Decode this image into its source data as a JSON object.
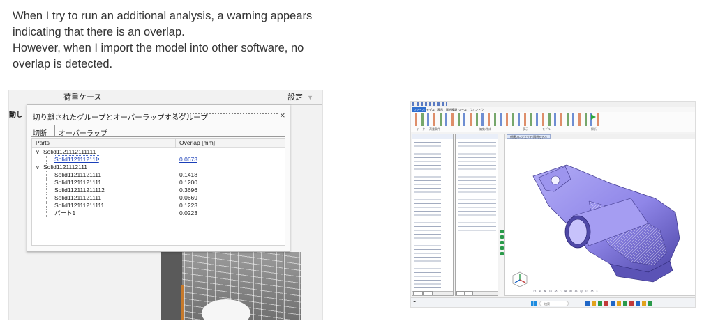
{
  "post": {
    "lines": [
      "When I try to run an additional analysis, a warning appears",
      "indicating that there is an overlap.",
      "However, when I import the model into other software, no",
      "overlap is detected."
    ]
  },
  "left_screenshot": {
    "tab_load_case": "荷重ケース",
    "tab_settings": "設定",
    "side_label": "動し",
    "dialog": {
      "title": "切り離されたグループとオーバーラップするグループ",
      "close": "×",
      "tabs": [
        "切断",
        "オーバーラップ"
      ],
      "columns": [
        "Parts",
        "Overlap [mm]"
      ],
      "rows": [
        {
          "name": "Solid1121112111111",
          "value": "",
          "level": 0,
          "expanded": true
        },
        {
          "name": "Solid1121112111",
          "value": "0.0673",
          "level": 1,
          "link": true
        },
        {
          "name": "Solid1121112111",
          "value": "",
          "level": 0,
          "expanded": true
        },
        {
          "name": "Solid11211121111",
          "value": "0.1418",
          "level": 1
        },
        {
          "name": "Solid11211121111",
          "value": "0.1200",
          "level": 1
        },
        {
          "name": "Solid112111211112",
          "value": "0.3696",
          "level": 1
        },
        {
          "name": "Solid11211121111",
          "value": "0.0669",
          "level": 1
        },
        {
          "name": "Solid112111211111",
          "value": "0.1223",
          "level": 1
        },
        {
          "name": "パート1",
          "value": "0.0223",
          "level": 1
        }
      ]
    }
  },
  "right_screenshot": {
    "menu": [
      "ファイル",
      "モデル",
      "表示",
      "解析種類",
      "ツール",
      "ウィンドウ"
    ],
    "ribbon_groups": [
      "データ",
      "荷重条件",
      "編集/作成",
      "表示",
      "モデル",
      "解析"
    ],
    "viewport_tab": "新規プロジェクト:解析モデル",
    "search_placeholder": "検索",
    "colors": {
      "model": "#8f86e8",
      "accent": "#2f6fd0"
    }
  }
}
